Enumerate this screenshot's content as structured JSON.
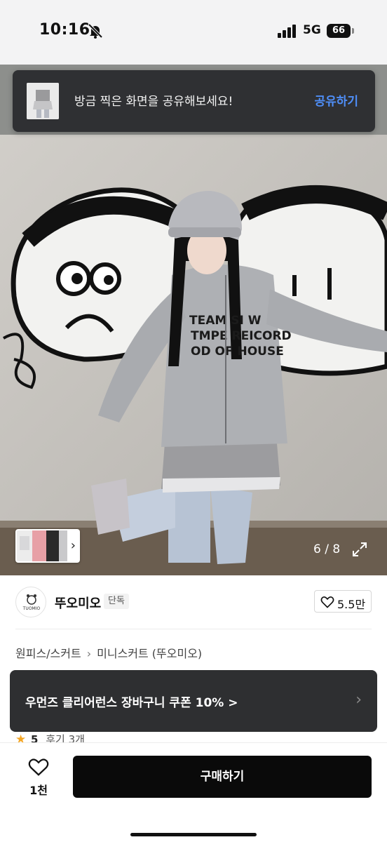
{
  "status_bar": {
    "time": "10:16",
    "network": "5G",
    "battery": "66"
  },
  "share_toast": {
    "message": "방금 찍은 화면을 공유해보세요!",
    "action": "공유하기"
  },
  "image_viewer": {
    "counter": "6 / 8",
    "current_index": 6,
    "total": 8,
    "graffiti_texts": [
      "TEAM SI W",
      "TMPE REICORD",
      "OD OF HOUSE"
    ]
  },
  "brand": {
    "logo_text": "TUOMIO",
    "name": "뚜오미오",
    "badge": "단독",
    "like_count": "5.5만"
  },
  "breadcrumb": [
    "원피스/스커트",
    "미니스커트 (뚜오미오)"
  ],
  "coupon_banner": {
    "text": "우먼즈 클리어런스 장바구니 쿠폰 10% >"
  },
  "rating": {
    "score": "5",
    "reviews": "후기 3개"
  },
  "bottom_bar": {
    "wish_count": "1천",
    "buy_label": "구매하기"
  },
  "colors": {
    "toast_bg": "#2f3033",
    "share_accent": "#4f8ef7",
    "coupon_bg": "#2e2f31",
    "buy_button": "#0a0a0a",
    "star": "#f5a623"
  },
  "icons": [
    "bell-slash-icon",
    "signal-icon",
    "battery-icon",
    "chevron-right-icon",
    "expand-icon",
    "heart-icon",
    "star-icon"
  ]
}
